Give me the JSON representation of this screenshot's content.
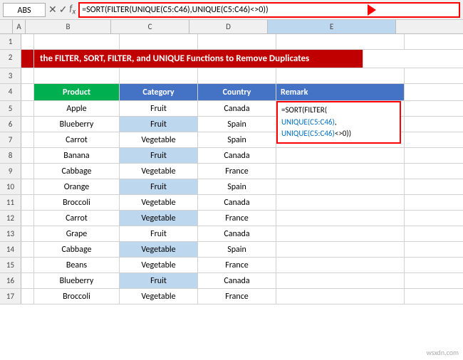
{
  "namebox": "ABS",
  "formula": "=SORT(FILTER(UNIQUE(C5:C46),UNIQUE(C5:C46)<>0))",
  "columns": {
    "a": "A",
    "b": "B",
    "c": "C",
    "d": "D",
    "e": "E"
  },
  "title": "the FILTER, SORT, FILTER, and UNIQUE Functions to Remove Duplicates",
  "headers": {
    "product": "Product",
    "category": "Category",
    "country": "Country",
    "remark": "Remark"
  },
  "rows": [
    {
      "num": 5,
      "product": "Apple",
      "category": "Fruit",
      "country": "Canada"
    },
    {
      "num": 6,
      "product": "Blueberry",
      "category": "Fruit",
      "country": "Spain"
    },
    {
      "num": 7,
      "product": "Carrot",
      "category": "Vegetable",
      "country": "Spain"
    },
    {
      "num": 8,
      "product": "Banana",
      "category": "Fruit",
      "country": "Canada"
    },
    {
      "num": 9,
      "product": "Cabbage",
      "category": "Vegetable",
      "country": "France"
    },
    {
      "num": 10,
      "product": "Orange",
      "category": "Fruit",
      "country": "Spain"
    },
    {
      "num": 11,
      "product": "Broccoli",
      "category": "Vegetable",
      "country": "Canada"
    },
    {
      "num": 12,
      "product": "Carrot",
      "category": "Vegetable",
      "country": "France"
    },
    {
      "num": 13,
      "product": "Grape",
      "category": "Fruit",
      "country": "Canada"
    },
    {
      "num": 14,
      "product": "Cabbage",
      "category": "Vegetable",
      "country": "Spain"
    },
    {
      "num": 15,
      "product": "Beans",
      "category": "Vegetable",
      "country": "France"
    },
    {
      "num": 16,
      "product": "Blueberry",
      "category": "Fruit",
      "country": "Canada"
    },
    {
      "num": 17,
      "product": "Broccoli",
      "category": "Vegetable",
      "country": "France"
    }
  ],
  "remark_formula": "=SORT(FILTER(\nUNIQUE(C5:C46),\nUNIQUE(C5:C46)<>0))",
  "watermark": "wsxdn.com"
}
